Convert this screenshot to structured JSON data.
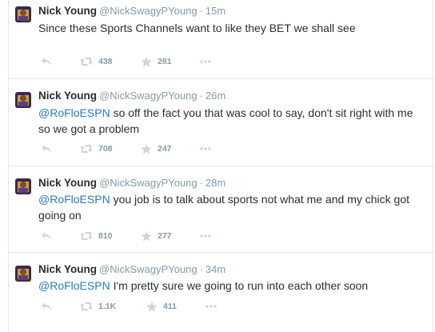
{
  "tweets": [
    {
      "name": "Nick Young",
      "handle": "@NickSwagyPYoung",
      "separator": "·",
      "time": "15m",
      "mention": "",
      "text": "Since these Sports Channels want to like they BET we shall see",
      "retweets": "438",
      "favorites": "281"
    },
    {
      "name": "Nick Young",
      "handle": "@NickSwagyPYoung",
      "separator": "·",
      "time": "26m",
      "mention": "@RoFloESPN",
      "text": " so off the fact you that was cool to say, don't sit right with me so we got a problem",
      "retweets": "708",
      "favorites": "247"
    },
    {
      "name": "Nick Young",
      "handle": "@NickSwagyPYoung",
      "separator": "·",
      "time": "28m",
      "mention": "@RoFloESPN",
      "text": " you job is to talk about sports  not what me and my chick got going on",
      "retweets": "810",
      "favorites": "277"
    },
    {
      "name": "Nick Young",
      "handle": "@NickSwagyPYoung",
      "separator": "·",
      "time": "34m",
      "mention": "@RoFloESPN",
      "text": " I'm pretty sure we going to run into each other soon",
      "retweets": "1.1K",
      "favorites": "411"
    }
  ],
  "icons": {
    "reply": "reply-icon",
    "retweet": "retweet-icon",
    "favorite": "star-icon",
    "more": "more-icon"
  },
  "colors": {
    "name": "#292f33",
    "meta": "#8899a6",
    "mention": "#2b7bb9",
    "action_icon": "#aab8c2",
    "divider": "#e1e8ed"
  }
}
